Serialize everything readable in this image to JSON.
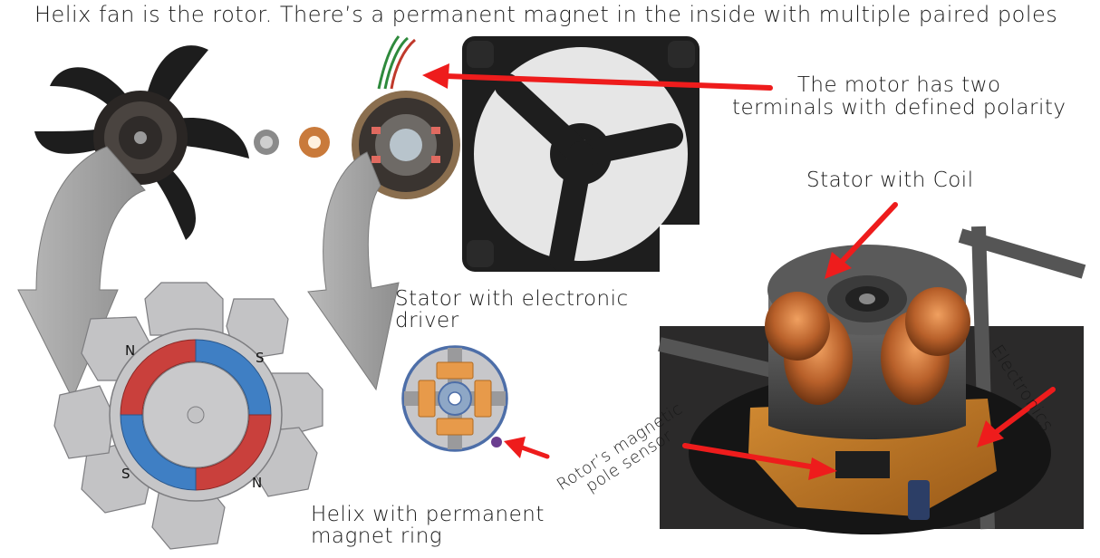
{
  "title": "Helix fan is the rotor. There’s a permanent magnet in the inside with multiple paired poles",
  "labels": {
    "motor_terminals_line1": "The motor has two",
    "motor_terminals_line2": "terminals with defined polarity",
    "stator_with_coil": "Stator with Coil",
    "stator_driver_line1": "Stator with electronic",
    "stator_driver_line2": "driver",
    "helix_line1": "Helix with permanent",
    "helix_line2": "magnet ring",
    "electronics": "Electronics",
    "sensor_line1": "Rotor’s magnetic",
    "sensor_line2": "pole sensor"
  },
  "poles": {
    "top_left": "N",
    "top_right": "S",
    "bottom_left": "S",
    "bottom_right": "N"
  },
  "colors": {
    "arrow_red": "#ee1c1c",
    "gray_arrow": "#a6a6a6",
    "pole_piece": "#c3c3c5",
    "magnet_red": "#c9403c",
    "magnet_blue": "#3f7fc4",
    "coil_orange": "#e79a4a",
    "stator_blue": "#4d6ea8",
    "sensor_purple": "#6a3d8f"
  }
}
